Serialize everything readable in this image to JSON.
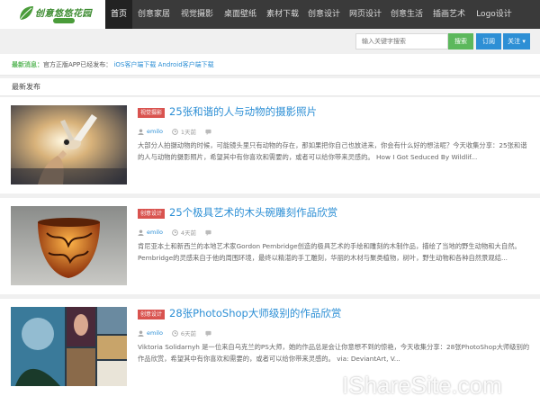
{
  "header": {
    "logo_text": "创意悠悠花园",
    "nav": [
      {
        "label": "首页",
        "active": true
      },
      {
        "label": "创意家居",
        "active": false
      },
      {
        "label": "视觉摄影",
        "active": false
      },
      {
        "label": "桌面壁纸",
        "active": false
      },
      {
        "label": "素材下载",
        "active": false
      },
      {
        "label": "创意设计",
        "active": false
      },
      {
        "label": "网页设计",
        "active": false
      },
      {
        "label": "创意生活",
        "active": false
      },
      {
        "label": "插画艺术",
        "active": false
      },
      {
        "label": "Logo设计",
        "active": false
      }
    ]
  },
  "search": {
    "placeholder": "输入关键字搜索",
    "button": "搜索",
    "subscribe": "订阅",
    "follow": "关注 ▾"
  },
  "notice": {
    "label": "最新消息：",
    "text": "官方正版APP已经发布：",
    "link1": "iOS客户端下载",
    "link2": "Android客户端下载"
  },
  "section_title": "最新发布",
  "posts": [
    {
      "tag": "视觉摄影",
      "title": "25张和谐的人与动物的摄影照片",
      "author": "emilo",
      "time": "1天前",
      "excerpt": "大部分人拍摄动物的时候，可能镜头里只有动物的存在，那如果把你自己也放进来，你会有什么好的想法呢？今天收集分享：25张和谐的人与动物的摄影照片，希望其中有你喜欢和需要的，或者可以给你带来灵感的。 How I Got Seduced By Wildlif..."
    },
    {
      "tag": "创意设计",
      "title": "25个极具艺术的木头碗雕刻作品欣赏",
      "author": "emilo",
      "time": "4天前",
      "excerpt": "肯尼亚本土和新西兰的本地艺术家Gordon Pembridge创造的极具艺术的手绘和雕刻的木制作品，描绘了当地的野生动物和大自然。 Pembridge的灵感来自于他的周围环境，最终以精湛的手工雕刻，华丽的木材与聚类植物，树叶，野生动物和各种自然景观结..."
    },
    {
      "tag": "创意设计",
      "title": "28张PhotoShop大师级别的作品欣赏",
      "author": "emilo",
      "time": "6天前",
      "excerpt": "Viktoria Solidarnyh 是一位来自乌克兰的PS大师，她的作品总是会让你意想不到的惊艳，今天收集分享：28张PhotoShop大师级别的作品欣赏，希望其中有你喜欢和需要的，或者可以给你带来灵感的。 via: DeviantArt, V..."
    }
  ],
  "watermark": "IShareSite.com",
  "colors": {
    "accent": "#2d8fd5",
    "tag": "#d9534f",
    "green": "#5cb85c",
    "nav_bg": "#3a3a3a"
  }
}
